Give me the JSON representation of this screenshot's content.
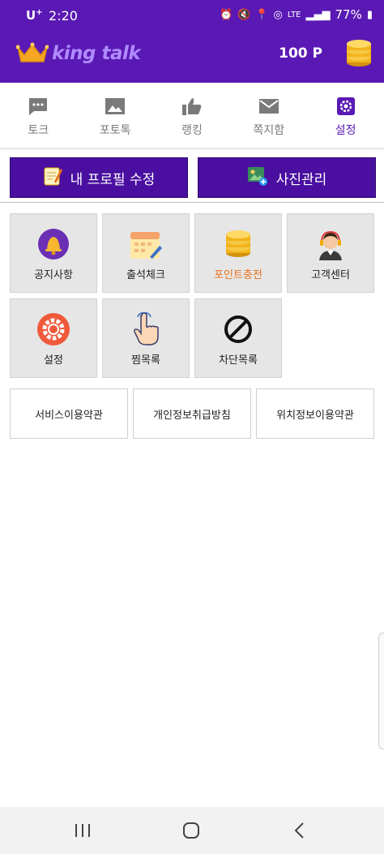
{
  "status": {
    "carrier": "U",
    "carrier_sup": "+",
    "time": "2:20",
    "network": "LTE",
    "battery": "77%"
  },
  "header": {
    "app_name": "king talk",
    "points": "100 P"
  },
  "tabs": [
    {
      "label": "토크",
      "icon": "chat-bubble-icon"
    },
    {
      "label": "포토톡",
      "icon": "photo-icon"
    },
    {
      "label": "랭킹",
      "icon": "thumbs-up-icon"
    },
    {
      "label": "쪽지함",
      "icon": "envelope-icon"
    },
    {
      "label": "설정",
      "icon": "gear-icon",
      "active": true
    }
  ],
  "actions": {
    "edit_profile": "내 프로필 수정",
    "photo_manage": "사진관리"
  },
  "menu": [
    {
      "label": "공지사항",
      "icon": "bell-icon"
    },
    {
      "label": "출석체크",
      "icon": "calendar-icon"
    },
    {
      "label": "포인트충전",
      "icon": "coins-icon",
      "highlight": true
    },
    {
      "label": "고객센터",
      "icon": "headset-agent-icon"
    },
    {
      "label": "설정",
      "icon": "settings-gear-icon"
    },
    {
      "label": "찜목록",
      "icon": "pointing-hand-icon"
    },
    {
      "label": "차단목록",
      "icon": "block-icon"
    }
  ],
  "policies": {
    "service_terms": "서비스이용약관",
    "privacy": "개인정보취급방침",
    "location_terms": "위치정보이용약관"
  },
  "colors": {
    "primary": "#5a19b4",
    "button": "#4a0fa0",
    "highlight": "#e8701a"
  }
}
